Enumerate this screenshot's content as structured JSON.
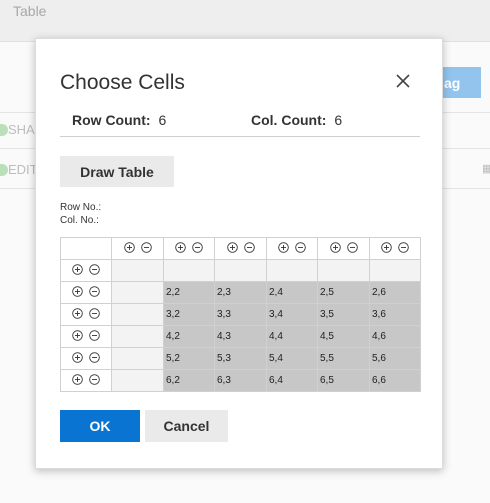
{
  "background": {
    "title": "Table",
    "button_label": "ag",
    "side_items": [
      {
        "label": "SHA"
      },
      {
        "label": "EDIT"
      }
    ],
    "grid_icon": "table-icon"
  },
  "dialog": {
    "title": "Choose Cells",
    "close_icon": "close-icon",
    "row_count_label": "Row Count:",
    "row_count_value": "6",
    "col_count_label": "Col. Count:",
    "col_count_value": "6",
    "draw_button": "Draw Table",
    "row_no_label": "Row No.:",
    "col_no_label": "Col. No.:",
    "rows": [
      [
        "2,2",
        "2,3",
        "2,4",
        "2,5",
        "2,6"
      ],
      [
        "3,2",
        "3,3",
        "3,4",
        "3,5",
        "3,6"
      ],
      [
        "4,2",
        "4,3",
        "4,4",
        "4,5",
        "4,6"
      ],
      [
        "5,2",
        "5,3",
        "5,4",
        "5,5",
        "5,6"
      ],
      [
        "6,2",
        "6,3",
        "6,4",
        "6,5",
        "6,6"
      ]
    ],
    "ok_button": "OK",
    "cancel_button": "Cancel"
  },
  "colors": {
    "primary": "#0a74d3",
    "selected_cell": "#c7c7c7"
  }
}
